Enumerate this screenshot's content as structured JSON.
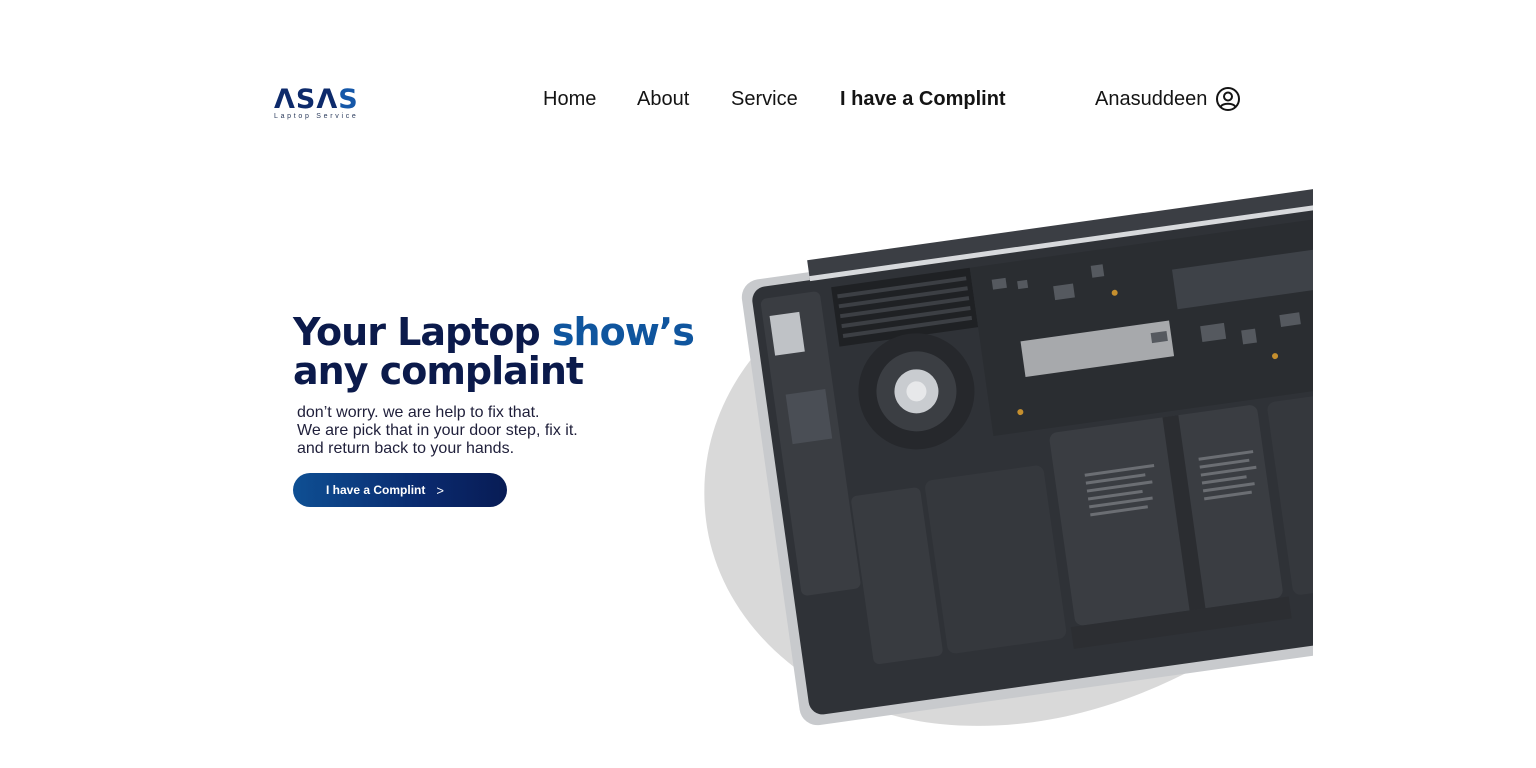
{
  "brand": {
    "logo_text_a": "ΛSΛ",
    "logo_text_b": "S",
    "tagline": "Laptop Service",
    "colors": {
      "navy": "#0b1a4b",
      "blue": "#0f559e"
    }
  },
  "nav": {
    "items": [
      {
        "label": "Home"
      },
      {
        "label": "About"
      },
      {
        "label": "Service"
      },
      {
        "label": "I have a Complint",
        "active": true
      }
    ]
  },
  "user": {
    "name": "Anasuddeen",
    "icon": "user-circle-icon"
  },
  "hero": {
    "title_part1": "Your Laptop ",
    "title_highlight": "show’s",
    "title_line2": "any complaint",
    "description": [
      "don’t worry. we are help to fix that.",
      "We are pick that in your door step, fix it.",
      "and return back to your hands."
    ],
    "cta_label": "I have a Complint",
    "cta_arrow": ">",
    "image": "laptop-internals-image",
    "blob_color": "#d9d9d9"
  }
}
